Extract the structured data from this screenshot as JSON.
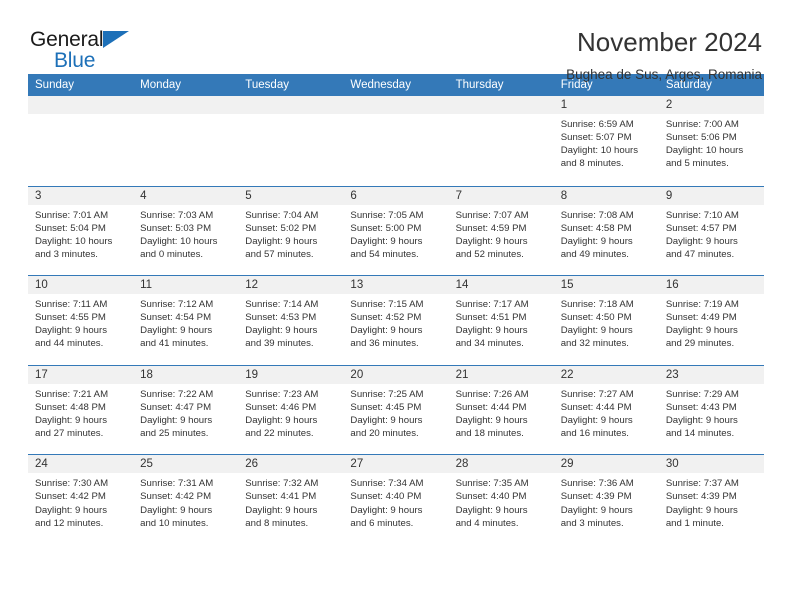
{
  "logo": {
    "word_top": "General",
    "word_bottom": "Blue",
    "triangle_color": "#1d70b8"
  },
  "header": {
    "title": "November 2024",
    "subtitle": "Bughea de Sus, Arges, Romania"
  },
  "theme": {
    "header_blue": "#3479b8",
    "daynum_gray": "#f1f1f1",
    "text": "#333333"
  },
  "weekdays": [
    "Sunday",
    "Monday",
    "Tuesday",
    "Wednesday",
    "Thursday",
    "Friday",
    "Saturday"
  ],
  "labels": {
    "sunrise": "Sunrise:",
    "sunset": "Sunset:",
    "daylight": "Daylight:"
  },
  "weeks": [
    [
      {
        "day": "",
        "empty": true
      },
      {
        "day": "",
        "empty": true
      },
      {
        "day": "",
        "empty": true
      },
      {
        "day": "",
        "empty": true
      },
      {
        "day": "",
        "empty": true
      },
      {
        "day": "1",
        "sunrise": "Sunrise: 6:59 AM",
        "sunset": "Sunset: 5:07 PM",
        "daylight_1": "Daylight: 10 hours",
        "daylight_2": "and 8 minutes."
      },
      {
        "day": "2",
        "sunrise": "Sunrise: 7:00 AM",
        "sunset": "Sunset: 5:06 PM",
        "daylight_1": "Daylight: 10 hours",
        "daylight_2": "and 5 minutes."
      }
    ],
    [
      {
        "day": "3",
        "sunrise": "Sunrise: 7:01 AM",
        "sunset": "Sunset: 5:04 PM",
        "daylight_1": "Daylight: 10 hours",
        "daylight_2": "and 3 minutes."
      },
      {
        "day": "4",
        "sunrise": "Sunrise: 7:03 AM",
        "sunset": "Sunset: 5:03 PM",
        "daylight_1": "Daylight: 10 hours",
        "daylight_2": "and 0 minutes."
      },
      {
        "day": "5",
        "sunrise": "Sunrise: 7:04 AM",
        "sunset": "Sunset: 5:02 PM",
        "daylight_1": "Daylight: 9 hours",
        "daylight_2": "and 57 minutes."
      },
      {
        "day": "6",
        "sunrise": "Sunrise: 7:05 AM",
        "sunset": "Sunset: 5:00 PM",
        "daylight_1": "Daylight: 9 hours",
        "daylight_2": "and 54 minutes."
      },
      {
        "day": "7",
        "sunrise": "Sunrise: 7:07 AM",
        "sunset": "Sunset: 4:59 PM",
        "daylight_1": "Daylight: 9 hours",
        "daylight_2": "and 52 minutes."
      },
      {
        "day": "8",
        "sunrise": "Sunrise: 7:08 AM",
        "sunset": "Sunset: 4:58 PM",
        "daylight_1": "Daylight: 9 hours",
        "daylight_2": "and 49 minutes."
      },
      {
        "day": "9",
        "sunrise": "Sunrise: 7:10 AM",
        "sunset": "Sunset: 4:57 PM",
        "daylight_1": "Daylight: 9 hours",
        "daylight_2": "and 47 minutes."
      }
    ],
    [
      {
        "day": "10",
        "sunrise": "Sunrise: 7:11 AM",
        "sunset": "Sunset: 4:55 PM",
        "daylight_1": "Daylight: 9 hours",
        "daylight_2": "and 44 minutes."
      },
      {
        "day": "11",
        "sunrise": "Sunrise: 7:12 AM",
        "sunset": "Sunset: 4:54 PM",
        "daylight_1": "Daylight: 9 hours",
        "daylight_2": "and 41 minutes."
      },
      {
        "day": "12",
        "sunrise": "Sunrise: 7:14 AM",
        "sunset": "Sunset: 4:53 PM",
        "daylight_1": "Daylight: 9 hours",
        "daylight_2": "and 39 minutes."
      },
      {
        "day": "13",
        "sunrise": "Sunrise: 7:15 AM",
        "sunset": "Sunset: 4:52 PM",
        "daylight_1": "Daylight: 9 hours",
        "daylight_2": "and 36 minutes."
      },
      {
        "day": "14",
        "sunrise": "Sunrise: 7:17 AM",
        "sunset": "Sunset: 4:51 PM",
        "daylight_1": "Daylight: 9 hours",
        "daylight_2": "and 34 minutes."
      },
      {
        "day": "15",
        "sunrise": "Sunrise: 7:18 AM",
        "sunset": "Sunset: 4:50 PM",
        "daylight_1": "Daylight: 9 hours",
        "daylight_2": "and 32 minutes."
      },
      {
        "day": "16",
        "sunrise": "Sunrise: 7:19 AM",
        "sunset": "Sunset: 4:49 PM",
        "daylight_1": "Daylight: 9 hours",
        "daylight_2": "and 29 minutes."
      }
    ],
    [
      {
        "day": "17",
        "sunrise": "Sunrise: 7:21 AM",
        "sunset": "Sunset: 4:48 PM",
        "daylight_1": "Daylight: 9 hours",
        "daylight_2": "and 27 minutes."
      },
      {
        "day": "18",
        "sunrise": "Sunrise: 7:22 AM",
        "sunset": "Sunset: 4:47 PM",
        "daylight_1": "Daylight: 9 hours",
        "daylight_2": "and 25 minutes."
      },
      {
        "day": "19",
        "sunrise": "Sunrise: 7:23 AM",
        "sunset": "Sunset: 4:46 PM",
        "daylight_1": "Daylight: 9 hours",
        "daylight_2": "and 22 minutes."
      },
      {
        "day": "20",
        "sunrise": "Sunrise: 7:25 AM",
        "sunset": "Sunset: 4:45 PM",
        "daylight_1": "Daylight: 9 hours",
        "daylight_2": "and 20 minutes."
      },
      {
        "day": "21",
        "sunrise": "Sunrise: 7:26 AM",
        "sunset": "Sunset: 4:44 PM",
        "daylight_1": "Daylight: 9 hours",
        "daylight_2": "and 18 minutes."
      },
      {
        "day": "22",
        "sunrise": "Sunrise: 7:27 AM",
        "sunset": "Sunset: 4:44 PM",
        "daylight_1": "Daylight: 9 hours",
        "daylight_2": "and 16 minutes."
      },
      {
        "day": "23",
        "sunrise": "Sunrise: 7:29 AM",
        "sunset": "Sunset: 4:43 PM",
        "daylight_1": "Daylight: 9 hours",
        "daylight_2": "and 14 minutes."
      }
    ],
    [
      {
        "day": "24",
        "sunrise": "Sunrise: 7:30 AM",
        "sunset": "Sunset: 4:42 PM",
        "daylight_1": "Daylight: 9 hours",
        "daylight_2": "and 12 minutes."
      },
      {
        "day": "25",
        "sunrise": "Sunrise: 7:31 AM",
        "sunset": "Sunset: 4:42 PM",
        "daylight_1": "Daylight: 9 hours",
        "daylight_2": "and 10 minutes."
      },
      {
        "day": "26",
        "sunrise": "Sunrise: 7:32 AM",
        "sunset": "Sunset: 4:41 PM",
        "daylight_1": "Daylight: 9 hours",
        "daylight_2": "and 8 minutes."
      },
      {
        "day": "27",
        "sunrise": "Sunrise: 7:34 AM",
        "sunset": "Sunset: 4:40 PM",
        "daylight_1": "Daylight: 9 hours",
        "daylight_2": "and 6 minutes."
      },
      {
        "day": "28",
        "sunrise": "Sunrise: 7:35 AM",
        "sunset": "Sunset: 4:40 PM",
        "daylight_1": "Daylight: 9 hours",
        "daylight_2": "and 4 minutes."
      },
      {
        "day": "29",
        "sunrise": "Sunrise: 7:36 AM",
        "sunset": "Sunset: 4:39 PM",
        "daylight_1": "Daylight: 9 hours",
        "daylight_2": "and 3 minutes."
      },
      {
        "day": "30",
        "sunrise": "Sunrise: 7:37 AM",
        "sunset": "Sunset: 4:39 PM",
        "daylight_1": "Daylight: 9 hours",
        "daylight_2": "and 1 minute."
      }
    ]
  ]
}
